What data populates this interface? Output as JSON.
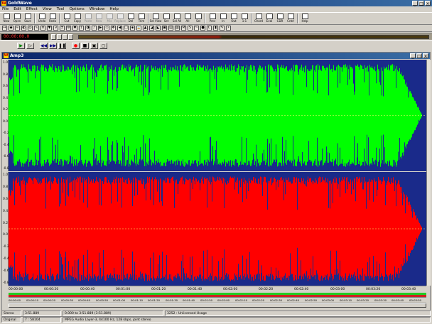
{
  "window": {
    "title": "GoldWave",
    "min": "_",
    "max": "□",
    "close": "×"
  },
  "menu": [
    "File",
    "Edit",
    "Effect",
    "View",
    "Tool",
    "Options",
    "Window",
    "Help"
  ],
  "toolbar": [
    {
      "label": "New",
      "icon": "new-file-icon",
      "enabled": true
    },
    {
      "label": "Open",
      "icon": "open-folder-icon",
      "enabled": true
    },
    {
      "label": "Save",
      "icon": "save-icon",
      "enabled": true
    },
    {
      "label": "Undo",
      "icon": "undo-icon",
      "enabled": true
    },
    {
      "label": "Redo",
      "icon": "redo-icon",
      "enabled": true
    },
    {
      "label": "Cut",
      "icon": "scissors-icon",
      "enabled": true
    },
    {
      "label": "Copy",
      "icon": "copy-icon",
      "enabled": true
    },
    {
      "label": "Paste",
      "icon": "paste-icon",
      "enabled": false
    },
    {
      "label": "New",
      "icon": "paste-new-icon",
      "enabled": false
    },
    {
      "label": "Mix",
      "icon": "mix-icon",
      "enabled": false
    },
    {
      "label": "Replace",
      "icon": "replace-icon",
      "enabled": false
    },
    {
      "label": "Del",
      "icon": "delete-icon",
      "enabled": true
    },
    {
      "label": "Trim",
      "icon": "trim-icon",
      "enabled": true
    },
    {
      "label": "Sel View",
      "icon": "select-view-icon",
      "enabled": true
    },
    {
      "label": "Set",
      "icon": "set-marker-icon",
      "enabled": true
    },
    {
      "label": "Sel All",
      "icon": "select-all-icon",
      "enabled": true
    },
    {
      "label": "All",
      "icon": "view-all-icon",
      "enabled": true
    },
    {
      "label": "Sel",
      "icon": "view-selection-icon",
      "enabled": true
    },
    {
      "label": "Prev",
      "icon": "previous-icon",
      "enabled": true
    },
    {
      "label": "In",
      "icon": "zoom-in-icon",
      "enabled": true
    },
    {
      "label": "Out",
      "icon": "zoom-out-icon",
      "enabled": true
    },
    {
      "label": "1:1",
      "icon": "zoom-1-1-icon",
      "enabled": true
    },
    {
      "label": "Chord",
      "icon": "chord-icon",
      "enabled": true
    },
    {
      "label": "Eval",
      "icon": "expression-evaluator-icon",
      "enabled": true
    },
    {
      "label": "CDR",
      "icon": "cd-reader-icon",
      "enabled": true
    },
    {
      "label": "Cntrl",
      "icon": "control-icon",
      "enabled": true
    },
    {
      "label": "Help",
      "icon": "help-book-icon",
      "enabled": true
    }
  ],
  "effects_toolbar_icons": [
    "autocue-icon",
    "compressor-icon",
    "delay-icon",
    "doppler-icon",
    "echo-icon",
    "dynamics-icon",
    "equalizer-icon",
    "filter-icon",
    "flange-icon",
    "invert-icon",
    "mechanize-icon",
    "noise-reduction-icon",
    "offset-icon",
    "pan-icon",
    "pitch-icon",
    "playback-rate-icon",
    "resample-icon",
    "reverb-icon",
    "reverse-icon",
    "silence-icon",
    "spatial-icon",
    "time-warp-icon",
    "volume-icon",
    "fade-in-icon",
    "fade-out-icon",
    "match-volume-icon",
    "maximize-volume-icon",
    "shape-volume-icon",
    "mono-icon",
    "stereo-icon",
    "interpolate-icon",
    "cue-points-icon",
    "channel-icon",
    "marker-icon",
    "speech-icon",
    "generator-icon"
  ],
  "effects_toolbar_glyphs": [
    "↔",
    "◆",
    "≈",
    "◐",
    "◎",
    "∿",
    "≡",
    "▼",
    "∂",
    "±",
    "⚙",
    "✱",
    "↕",
    "◑",
    "♪",
    "▶",
    "◇",
    "❖",
    "◀",
    "□",
    "◈",
    "⌛",
    "▲",
    "◢",
    "◣",
    "▣",
    "▤",
    "▥",
    "M",
    "S",
    "~",
    "●",
    "C",
    "▮",
    "✎",
    "⚡"
  ],
  "control": {
    "time_display": "00:00:00.0",
    "level_label": ""
  },
  "transport": [
    {
      "name": "play-button",
      "glyph": "▶",
      "color": "#008000"
    },
    {
      "name": "play-selection-button",
      "glyph": "▷",
      "color": "#000000"
    },
    {
      "name": "rewind-button",
      "glyph": "◀◀",
      "color": "#000080"
    },
    {
      "name": "fast-forward-button",
      "glyph": "▶▶",
      "color": "#000080"
    },
    {
      "name": "pause-button",
      "glyph": "❚❚",
      "color": "#000000"
    },
    {
      "name": "record-button",
      "glyph": "●",
      "color": "#ff0000"
    },
    {
      "name": "stop-button",
      "glyph": "■",
      "color": "#000000"
    },
    {
      "name": "record-selection-button",
      "glyph": "▣",
      "color": "#000000"
    },
    {
      "name": "record-new-button",
      "glyph": "◻",
      "color": "#000000"
    }
  ],
  "document": {
    "title": "Amp3",
    "top_channel_color": "#00ff00",
    "bottom_channel_color": "#ff0000",
    "background_color": "#1a2a8a",
    "y_ticks": [
      "1.0",
      "0.8",
      "0.6",
      "0.4",
      "0.2",
      "0.0",
      "-0.2",
      "-0.4",
      "-0.6",
      "-0.8"
    ]
  },
  "time_ruler": [
    "00:00:00",
    "00:00:20",
    "00:00:40",
    "00:01:00",
    "00:01:20",
    "00:01:40",
    "00:02:00",
    "00:02:20",
    "00:02:40",
    "00:03:00",
    "00:03:20",
    "00:03:40"
  ],
  "overview_ruler": [
    "00:00:00",
    "00:00:10",
    "00:00:20",
    "00:00:30",
    "00:00:40",
    "00:00:50",
    "00:01:00",
    "00:01:10",
    "00:01:20",
    "00:01:30",
    "00:01:40",
    "00:01:50",
    "00:02:00",
    "00:02:10",
    "00:02:20",
    "00:02:30",
    "00:02:40",
    "00:02:50",
    "00:03:00",
    "00:03:10",
    "00:03:20",
    "00:03:30",
    "00:03:40",
    "00:03:50"
  ],
  "status1": {
    "channels": "Stereo",
    "length": "3:51.889",
    "range": "0.000 to 3:51.889 (3:51.889)",
    "info": "3252 : Unlicensed Usage"
  },
  "status2": {
    "mode": "Original",
    "position": "7 : 58104",
    "format": "MPEG Audio Layer-3, 44100 Hz, 128 kbps, joint stereo"
  }
}
